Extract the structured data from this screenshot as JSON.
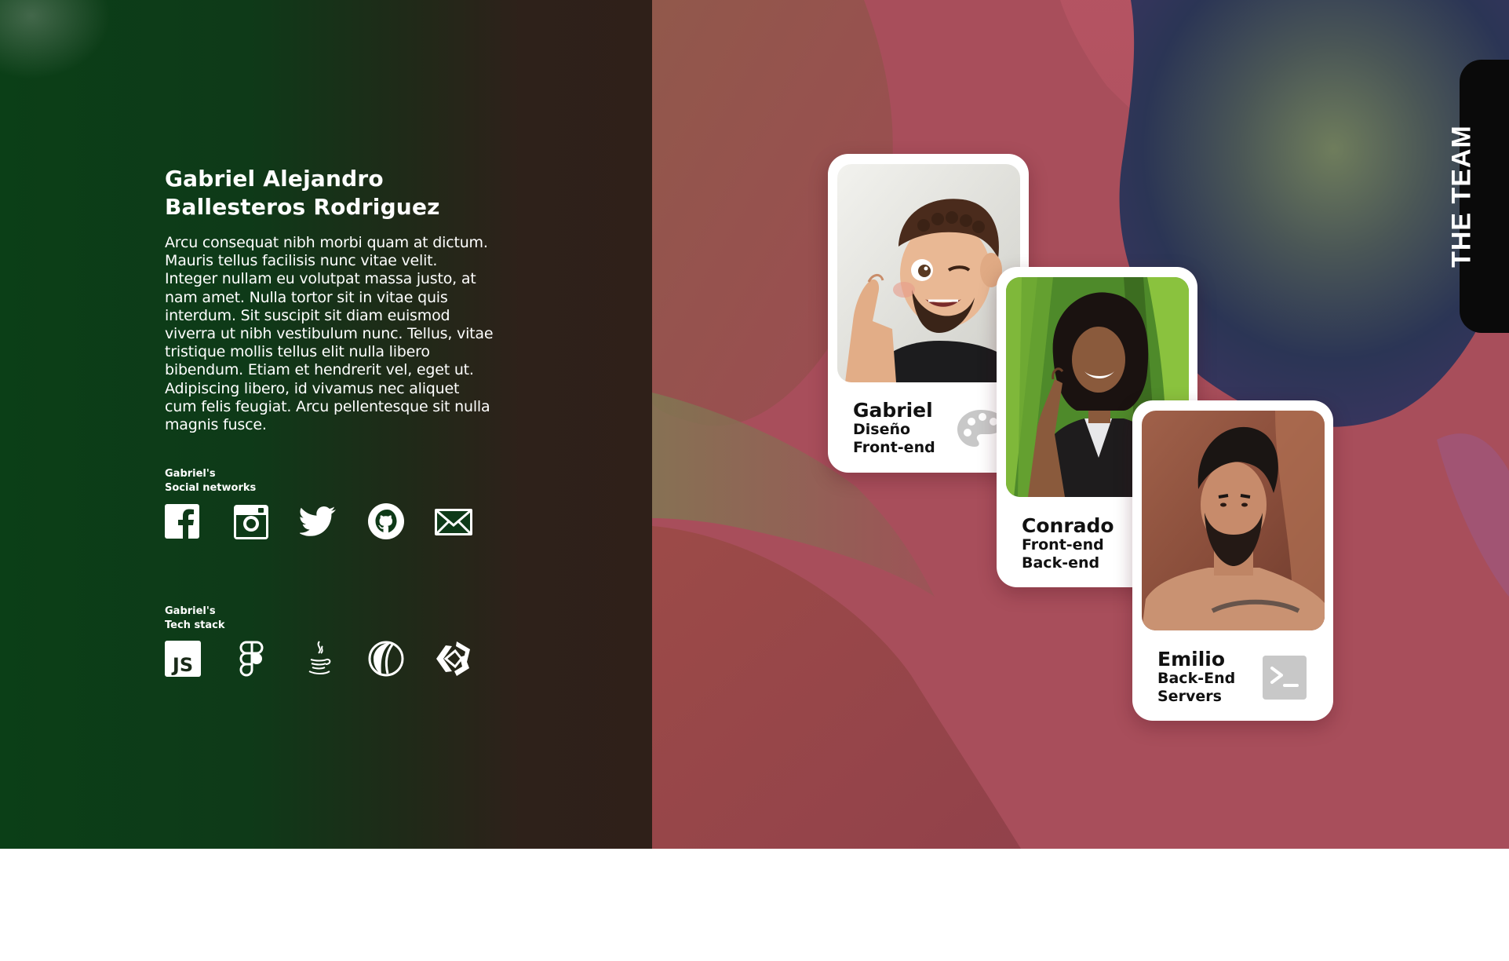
{
  "bio": {
    "name_line1": "Gabriel Alejandro",
    "name_line2": "Ballesteros Rodriguez",
    "text": "Arcu consequat nibh morbi quam at dictum. Mauris tellus facilisis nunc vitae velit. Integer nullam eu volutpat massa justo, at nam amet. Nulla tortor sit in vitae quis interdum. Sit suscipit sit diam euismod viverra ut nibh vestibulum nunc. Tellus, vitae tristique mollis tellus elit nulla libero bibendum. Etiam et hendrerit vel, eget ut. Adipiscing libero, id vivamus nec aliquet cum felis feugiat. Arcu pellentesque sit nulla magnis fusce."
  },
  "social": {
    "label_line1": "Gabriel's",
    "label_line2": "Social networks",
    "icons": [
      "facebook-icon",
      "instagram-icon",
      "twitter-icon",
      "github-icon",
      "mail-icon"
    ]
  },
  "tech": {
    "label_line1": "Gabriel's",
    "label_line2": "Tech stack",
    "js_label": "JS",
    "icons": [
      "javascript-icon",
      "figma-icon",
      "java-icon",
      "eclipse-icon",
      "unity-icon"
    ]
  },
  "cards": [
    {
      "name": "Gabriel",
      "role1": "Diseño",
      "role2": "Front-end",
      "icon": "palette-icon"
    },
    {
      "name": "Conrado",
      "role1": "Front-end",
      "role2": "Back-end",
      "icon": "code-file-icon"
    },
    {
      "name": "Emilio",
      "role1": "Back-End",
      "role2": "Servers",
      "icon": "terminal-icon"
    }
  ],
  "team_label": "THE TEAM",
  "colors": {
    "left_green": "#0b3f17",
    "left_brown": "#2f2019",
    "right_pink": "#b0505e",
    "blob_navy": "#2a3553",
    "blob_olive": "#6d7a5a",
    "tab_black": "#0a0a0a",
    "card_icon_grey": "#c8c8c8"
  }
}
